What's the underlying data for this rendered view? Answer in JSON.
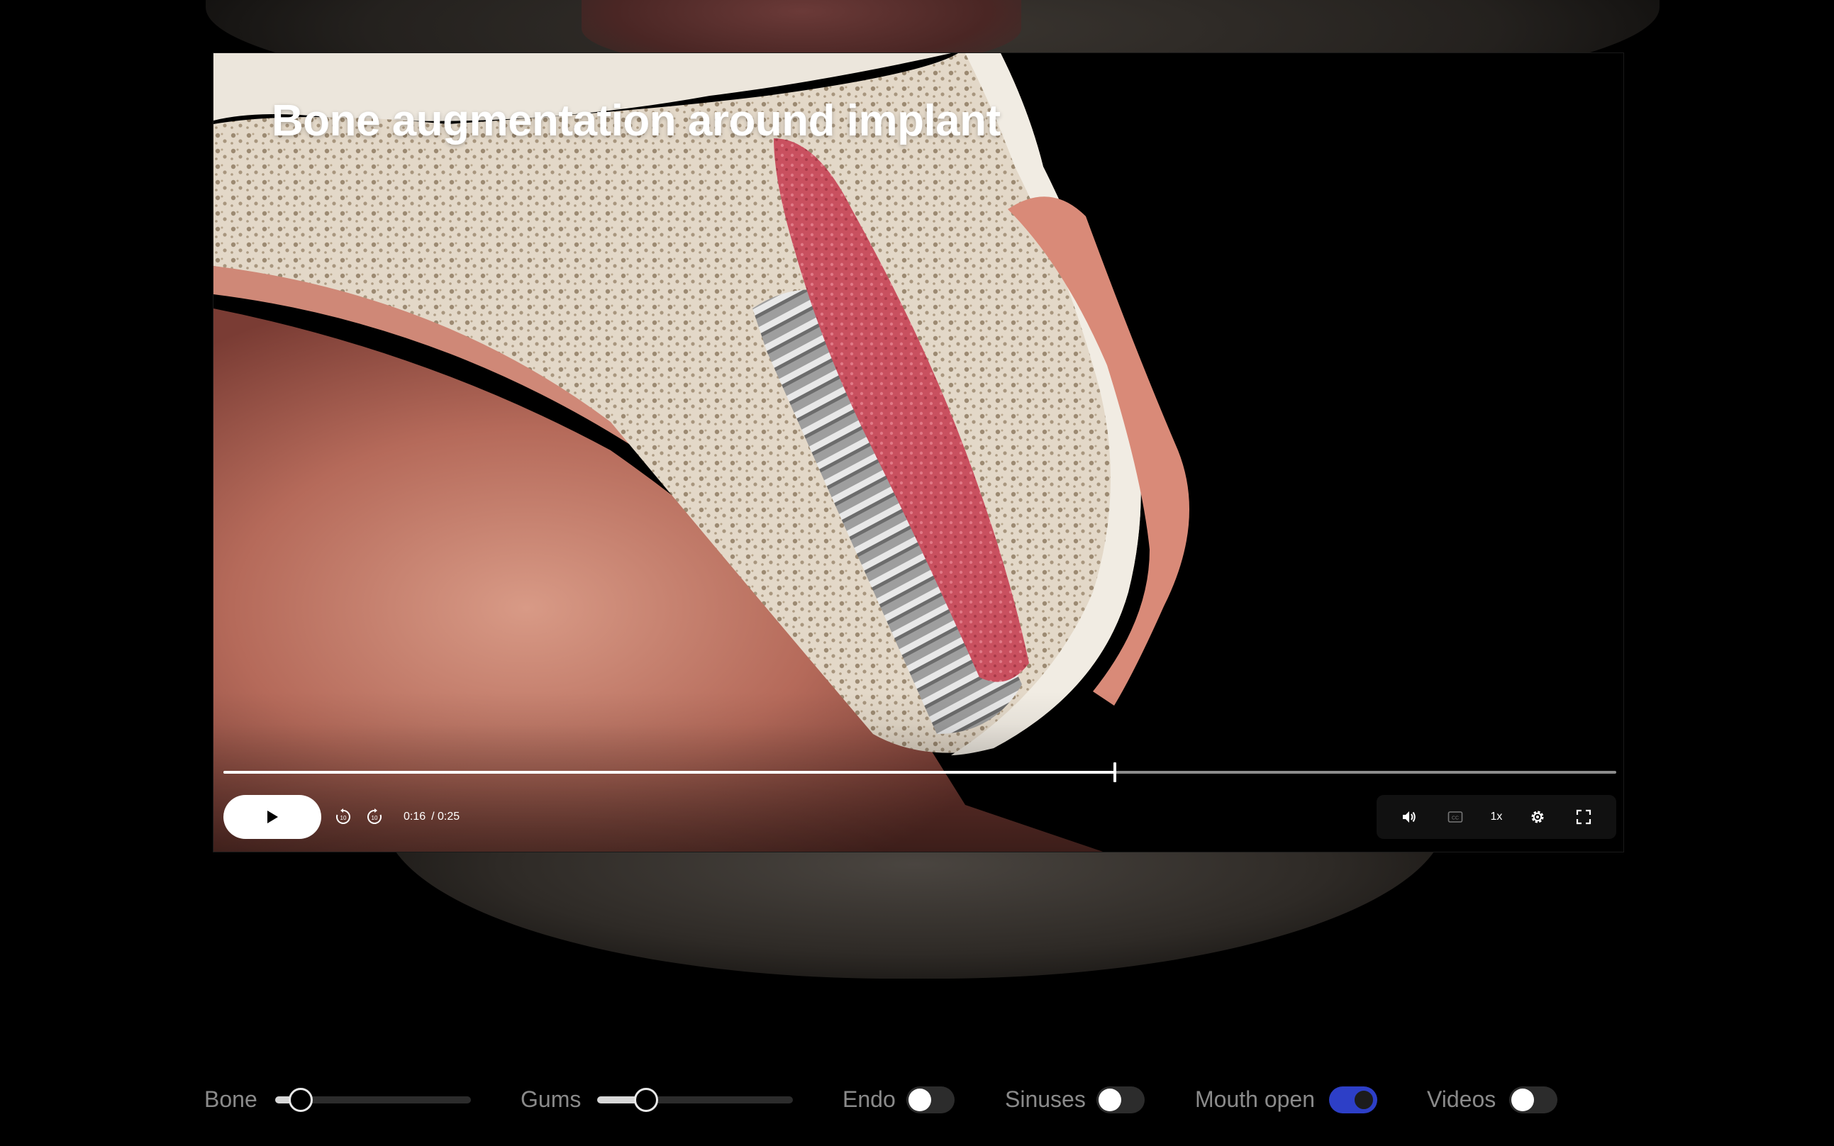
{
  "video": {
    "title": "Bone augmentation around implant",
    "current_time": "0:16",
    "duration": "/ 0:25",
    "progress_fraction": 0.64,
    "speed": "1x"
  },
  "icons": {
    "play": "play-icon",
    "rewind": "rewind-10-icon",
    "forward": "forward-10-icon",
    "volume": "volume-icon",
    "captions": "captions-icon",
    "settings": "gear-icon",
    "fullscreen": "fullscreen-icon"
  },
  "layers": {
    "bone": {
      "label": "Bone",
      "value_fraction": 0.13
    },
    "gums": {
      "label": "Gums",
      "value_fraction": 0.25
    },
    "endo": {
      "label": "Endo",
      "on": false
    },
    "sinuses": {
      "label": "Sinuses",
      "on": false
    },
    "mouth_open": {
      "label": "Mouth open",
      "on": true
    },
    "videos": {
      "label": "Videos",
      "on": false
    }
  },
  "colors": {
    "toggle_on": "#2d3fc7",
    "bone": "#e6dccd",
    "gum": "#c87a6e",
    "graft": "#c9505f"
  }
}
